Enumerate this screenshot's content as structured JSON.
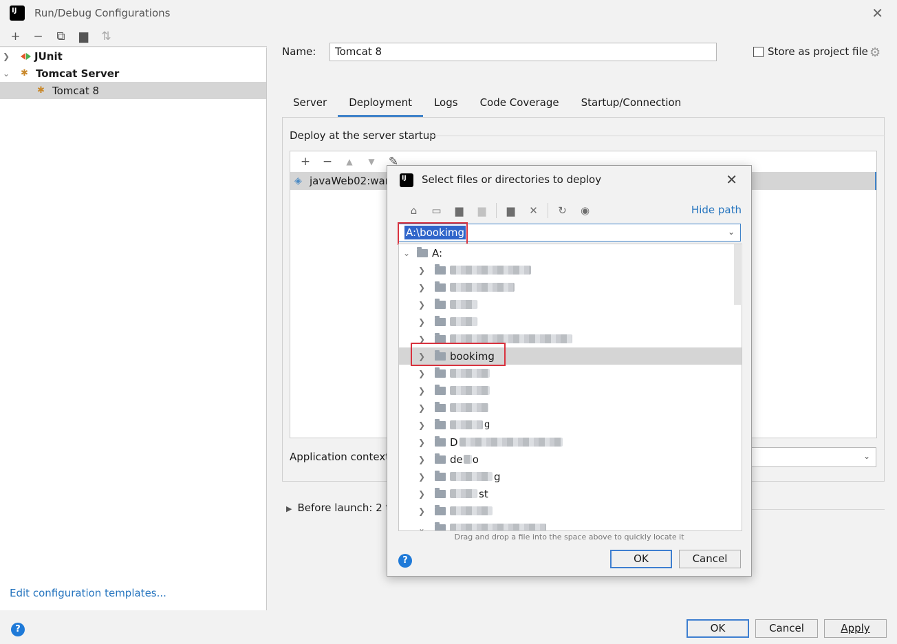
{
  "window": {
    "title": "Run/Debug Configurations"
  },
  "left_tree": [
    {
      "label": "JUnit",
      "expanded": false,
      "bold": true
    },
    {
      "label": "Tomcat Server",
      "expanded": true,
      "bold": true
    },
    {
      "label": "Tomcat 8",
      "selected": true
    }
  ],
  "edit_templates": "Edit configuration templates...",
  "form": {
    "name_label": "Name:",
    "name_value": "Tomcat 8",
    "store_label": "Store as project file",
    "store_checked": false
  },
  "tabs": [
    "Server",
    "Deployment",
    "Logs",
    "Code Coverage",
    "Startup/Connection"
  ],
  "active_tab": "Deployment",
  "deploy": {
    "section_title": "Deploy at the server startup",
    "item": "javaWeb02:war",
    "app_context_label": "Application context",
    "before_launch": "Before launch: 2 t"
  },
  "buttons": {
    "ok": "OK",
    "cancel": "Cancel",
    "apply": "Apply"
  },
  "dialog": {
    "title": "Select files or directories to deploy",
    "hide_path": "Hide path",
    "path_value": "A:\\bookimg",
    "root": "A:",
    "highlighted_item": "bookimg",
    "visible_fragments": [
      "A:",
      "bookimg",
      "de",
      "o",
      "g",
      "st",
      "D"
    ],
    "drag_hint": "Drag and drop a file into the space above to quickly locate it",
    "ok": "OK",
    "cancel": "Cancel"
  },
  "colors": {
    "accent": "#4083c9",
    "link": "#2675bf",
    "highlight_box": "#d9323e",
    "selection": "#2f65ca"
  }
}
